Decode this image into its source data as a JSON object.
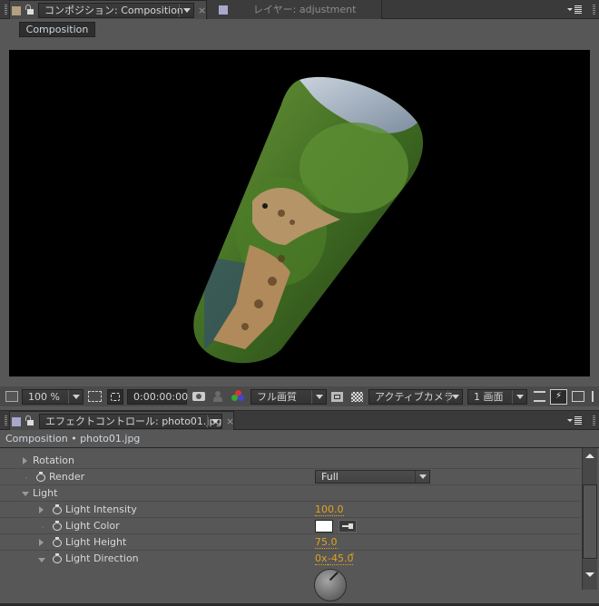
{
  "composition_panel": {
    "tab_label": "コンポジション: Composition",
    "tab_color": "#b4a07e",
    "inactive_tab_label": "レイヤー: adjustment",
    "inactive_tab_color": "#a8a8cc",
    "breadcrumb_button": "Composition",
    "viewer": {
      "content": "Photo of a giraffe among green trees wrapped onto a 3D cylinder, on black background"
    },
    "toolbar": {
      "magnification": "100 %",
      "timecode": "0:00:00:00",
      "resolution": "フル画質",
      "camera": "アクティブカメラ",
      "view_layout": "1 画面"
    },
    "icons": {
      "panel_menu": "panel-menu-icon",
      "snapshot": "camera-snapshot-icon",
      "show_snapshot": "person-icon",
      "channels": "rgb-channels-icon",
      "region_of_interest": "region-of-interest-icon",
      "transparency_grid": "checkerboard-icon",
      "fast_preview": "fast-preview-icon",
      "timeline": "timeline-icon",
      "flowchart": "flowchart-icon"
    }
  },
  "effect_controls_panel": {
    "tab_label": "エフェクトコントロール: photo01.jpg",
    "tab_color": "#a8a8cc",
    "breadcrumb": "Composition • photo01.jpg",
    "properties": [
      {
        "label": "Rotation",
        "indent": 1,
        "twirl": "collapsed",
        "stopwatch": false
      },
      {
        "label": "Render",
        "indent": 1,
        "twirl": "none",
        "stopwatch": true,
        "value": "Full",
        "control": "dropdown"
      },
      {
        "label": "Light",
        "indent": 1,
        "twirl": "expanded",
        "stopwatch": false
      },
      {
        "label": "Light Intensity",
        "indent": 2,
        "twirl": "collapsed",
        "stopwatch": true,
        "value": "100.0"
      },
      {
        "label": "Light Color",
        "indent": 2,
        "twirl": "none",
        "stopwatch": true,
        "value": "#ffffff",
        "control": "color"
      },
      {
        "label": "Light Height",
        "indent": 2,
        "twirl": "collapsed",
        "stopwatch": true,
        "value": "75.0"
      },
      {
        "label": "Light Direction",
        "indent": 2,
        "twirl": "expanded",
        "stopwatch": true,
        "value_revolutions": "0x",
        "value_degrees": "-45.0",
        "degree_symbol": "°",
        "control": "angle-dial",
        "angle_deg": -45
      }
    ]
  },
  "colors": {
    "value_orange": "#e0a21f",
    "panel_bg": "#575757",
    "tabbar_bg": "#3a3a3a"
  }
}
